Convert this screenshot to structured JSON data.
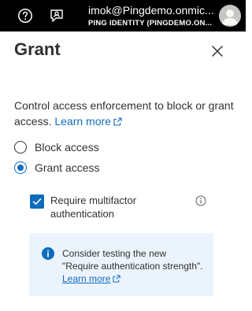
{
  "topbar": {
    "help_icon": "help-icon",
    "feedback_icon": "feedback-icon",
    "account_name": "imok@Pingdemo.onmic...",
    "directory": "PING IDENTITY (PINGDEMO.ON..."
  },
  "panel": {
    "title": "Grant",
    "description": "Control access enforcement to block or grant access.",
    "learn_more": "Learn more",
    "options": {
      "block": "Block access",
      "grant": "Grant access",
      "selected": "grant"
    },
    "mfa": {
      "label": "Require multifactor authentication",
      "checked": true
    },
    "info": {
      "text": "Consider testing the new \"Require authentication strength\".",
      "link": "Learn more"
    }
  },
  "colors": {
    "accent": "#0f6cbd",
    "topbar": "#000000",
    "info_bg": "#ebf3fc"
  }
}
